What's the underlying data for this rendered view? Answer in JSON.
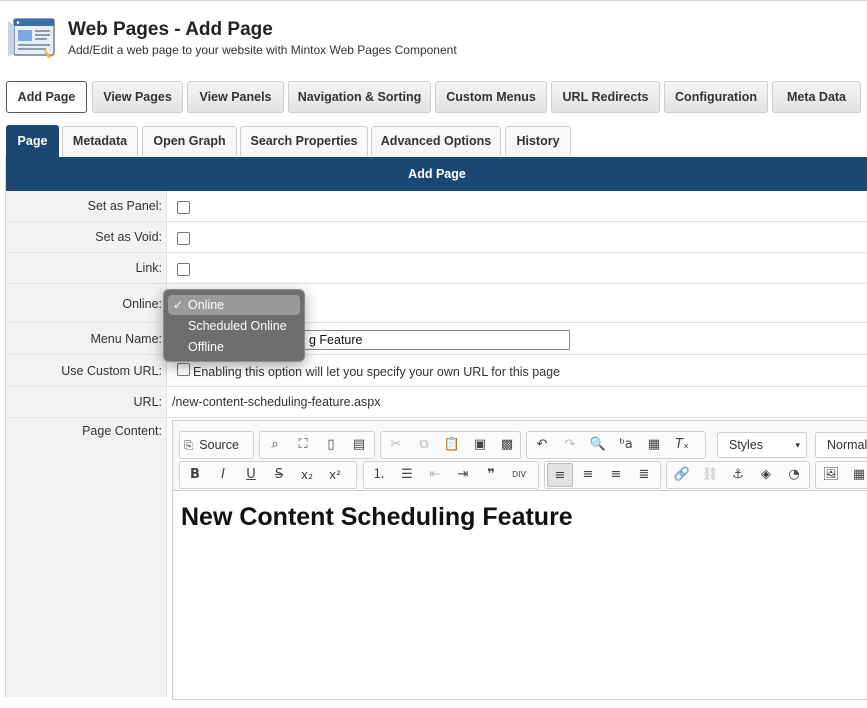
{
  "header": {
    "title": "Web Pages - Add Page",
    "subtitle": "Add/Edit a web page to your website with Mintox Web Pages Component",
    "logo_icon": "web-page-window-icon"
  },
  "nav_buttons": [
    {
      "label": "Add Page",
      "active": true
    },
    {
      "label": "View Pages"
    },
    {
      "label": "View Panels"
    },
    {
      "label": "Navigation & Sorting"
    },
    {
      "label": "Custom Menus"
    },
    {
      "label": "URL Redirects"
    },
    {
      "label": "Configuration"
    },
    {
      "label": "Meta Data"
    }
  ],
  "tabs": [
    {
      "label": "Page",
      "active": true
    },
    {
      "label": "Metadata"
    },
    {
      "label": "Open Graph"
    },
    {
      "label": "Search Properties"
    },
    {
      "label": "Advanced Options"
    },
    {
      "label": "History"
    }
  ],
  "form": {
    "heading": "Add Page",
    "set_as_panel_label": "Set as Panel:",
    "set_as_void_label": "Set as Void:",
    "link_label": "Link:",
    "online_label": "Online:",
    "menu_name_label": "Menu Name:",
    "menu_name_visible_value": "g Feature",
    "custom_url_label": "Use Custom URL:",
    "custom_url_hint": "Enabling this option will let you specify your own URL for this page",
    "url_label": "URL:",
    "url_value": "/new-content-scheduling-feature.aspx",
    "page_content_label": "Page Content:"
  },
  "online_dropdown": {
    "options": [
      "Online",
      "Scheduled Online",
      "Offline"
    ],
    "selected": "Online",
    "check_glyph": "✓"
  },
  "editor": {
    "source_label": "Source",
    "styles_label": "Styles",
    "format_label": "Normal",
    "content_heading": "New Content Scheduling Feature",
    "toolbar_icons": {
      "bold": "B",
      "italic": "I",
      "underline": "U",
      "strike": "S",
      "subscript": "x₂",
      "superscript": "x²",
      "blockquote": "❞",
      "div": "DIV"
    }
  },
  "colors": {
    "accent_navy": "#1b4873",
    "label_bg": "#f2f2f2",
    "dropdown_bg": "#6e6e6e"
  }
}
